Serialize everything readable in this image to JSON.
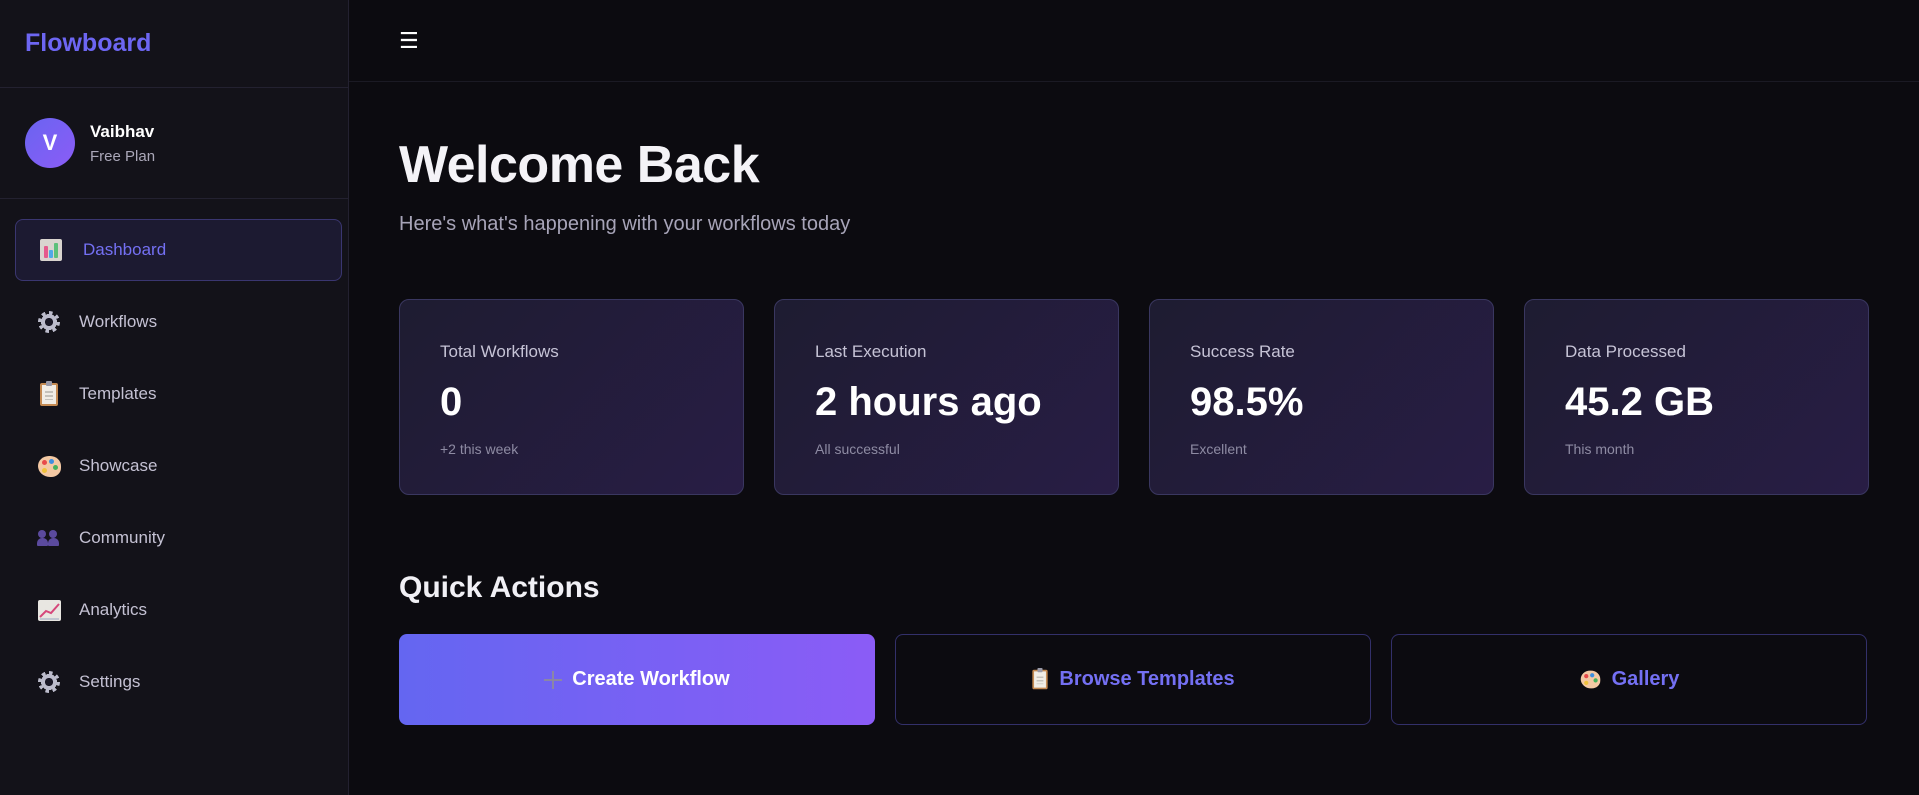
{
  "brand": {
    "name": "Flowboard",
    "color": "#6d66f2"
  },
  "user": {
    "initial": "V",
    "name": "Vaibhav",
    "plan": "Free Plan"
  },
  "sidebar": {
    "items": [
      {
        "label": "Dashboard",
        "icon": "bar-chart-icon",
        "active": true
      },
      {
        "label": "Workflows",
        "icon": "gear-icon",
        "active": false
      },
      {
        "label": "Templates",
        "icon": "clipboard-icon",
        "active": false
      },
      {
        "label": "Showcase",
        "icon": "palette-icon",
        "active": false
      },
      {
        "label": "Community",
        "icon": "people-icon",
        "active": false
      },
      {
        "label": "Analytics",
        "icon": "trend-chart-icon",
        "active": false
      },
      {
        "label": "Settings",
        "icon": "gear-icon",
        "active": false
      }
    ]
  },
  "topbar": {
    "menu_glyph": "☰",
    "menu_icon": "hamburger-menu-icon"
  },
  "header": {
    "title": "Welcome Back",
    "subtitle": "Here's what's happening with your workflows today"
  },
  "stats": [
    {
      "label": "Total Workflows",
      "value": "0",
      "note": "+2 this week"
    },
    {
      "label": "Last Execution",
      "value": "2 hours ago",
      "note": "All successful"
    },
    {
      "label": "Success Rate",
      "value": "98.5%",
      "note": "Excellent"
    },
    {
      "label": "Data Processed",
      "value": "45.2 GB",
      "note": "This month"
    }
  ],
  "quick_actions": {
    "title": "Quick Actions",
    "items": [
      {
        "label": "Create Workflow",
        "icon": "plus-icon"
      },
      {
        "label": "Browse Templates",
        "icon": "clipboard-icon"
      },
      {
        "label": "Gallery",
        "icon": "palette-icon"
      }
    ]
  },
  "colors": {
    "accent": "#6d66f2",
    "background": "#0c0b10",
    "sidebar_bg": "#131219",
    "gradient_start": "#6466f1",
    "gradient_end": "#8b5cf6"
  }
}
